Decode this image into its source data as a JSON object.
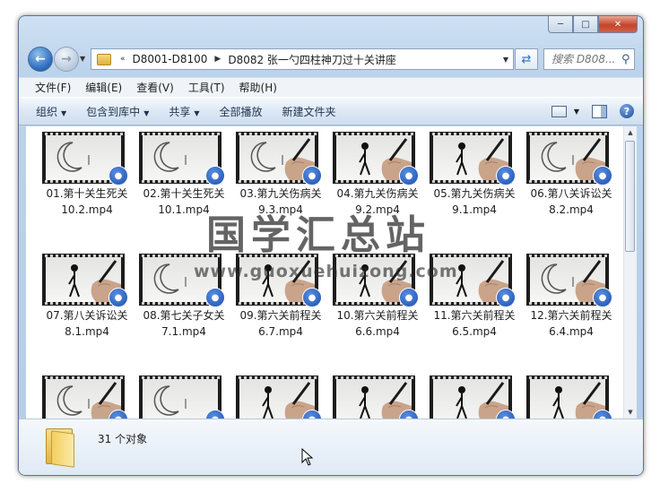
{
  "window": {
    "caption": {
      "minimize": "─",
      "maximize": "□",
      "close": "✕"
    }
  },
  "address": {
    "overflow": "«",
    "breadcrumbs": [
      "D8001-D8100",
      "D8082 张一勺四柱神刀过十关讲座"
    ],
    "search_placeholder": "搜索 D808..."
  },
  "menu": [
    "文件(F)",
    "编辑(E)",
    "查看(V)",
    "工具(T)",
    "帮助(H)"
  ],
  "toolbar": {
    "organize": "组织",
    "include_in_library": "包含到库中",
    "share": "共享",
    "play_all": "全部播放",
    "new_folder": "新建文件夹"
  },
  "files": [
    {
      "name": "01.第十关生死关10.2.mp4",
      "line1": "01.第十关生死关",
      "line2": "10.2.mp4",
      "thumb": "moon"
    },
    {
      "name": "02.第十关生死关10.1.mp4",
      "line1": "02.第十关生死关",
      "line2": "10.1.mp4",
      "thumb": "moon"
    },
    {
      "name": "03.第九关伤病关9.3.mp4",
      "line1": "03.第九关伤病关",
      "line2": "9.3.mp4",
      "thumb": "moon-hand"
    },
    {
      "name": "04.第九关伤病关9.2.mp4",
      "line1": "04.第九关伤病关",
      "line2": "9.2.mp4",
      "thumb": "figure-hand"
    },
    {
      "name": "05.第九关伤病关9.1.mp4",
      "line1": "05.第九关伤病关",
      "line2": "9.1.mp4",
      "thumb": "figure-hand"
    },
    {
      "name": "06.第八关诉讼关8.2.mp4",
      "line1": "06.第八关诉讼关",
      "line2": "8.2.mp4",
      "thumb": "moon-hand"
    },
    {
      "name": "07.第八关诉讼关8.1.mp4",
      "line1": "07.第八关诉讼关",
      "line2": "8.1.mp4",
      "thumb": "figure-hand"
    },
    {
      "name": "08.第七关子女关7.1.mp4",
      "line1": "08.第七关子女关",
      "line2": "7.1.mp4",
      "thumb": "moon"
    },
    {
      "name": "09.第六关前程关6.7.mp4",
      "line1": "09.第六关前程关",
      "line2": "6.7.mp4",
      "thumb": "figure-hand"
    },
    {
      "name": "10.第六关前程关6.6.mp4",
      "line1": "10.第六关前程关",
      "line2": "6.6.mp4",
      "thumb": "figure-hand"
    },
    {
      "name": "11.第六关前程关6.5.mp4",
      "line1": "11.第六关前程关",
      "line2": "6.5.mp4",
      "thumb": "figure-hand"
    },
    {
      "name": "12.第六关前程关6.4.mp4",
      "line1": "12.第六关前程关",
      "line2": "6.4.mp4",
      "thumb": "moon-hand"
    },
    {
      "name": "",
      "line1": "",
      "line2": "",
      "thumb": "moon-hand"
    },
    {
      "name": "",
      "line1": "",
      "line2": "",
      "thumb": "moon"
    },
    {
      "name": "",
      "line1": "",
      "line2": "",
      "thumb": "figure-hand"
    },
    {
      "name": "",
      "line1": "",
      "line2": "",
      "thumb": "figure-hand"
    },
    {
      "name": "",
      "line1": "",
      "line2": "",
      "thumb": "figure-hand"
    },
    {
      "name": "",
      "line1": "",
      "line2": "",
      "thumb": "figure-hand"
    }
  ],
  "status": {
    "count": "31 个对象"
  },
  "watermark": {
    "title": "国学汇总站",
    "url": "www.guoxuehuizong.com"
  },
  "icons": {
    "back": "back-arrow-icon",
    "forward": "forward-arrow-icon",
    "refresh": "refresh-icon",
    "search": "search-icon",
    "help": "help-icon",
    "badge": "media-player-icon"
  }
}
